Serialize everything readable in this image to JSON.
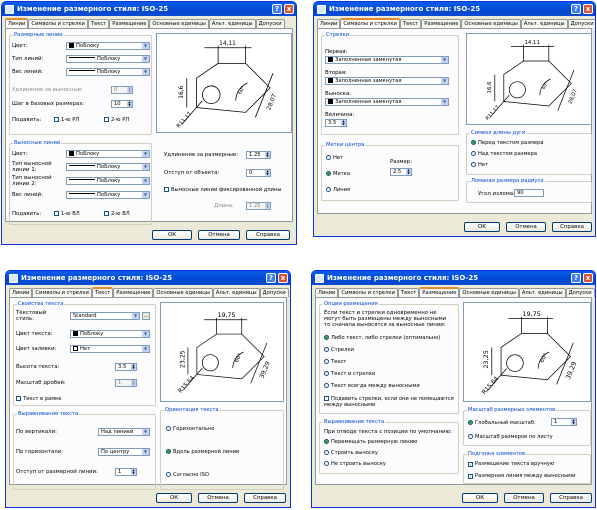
{
  "dialogs": [
    {
      "title": "Изменение размерного стиля: ISO-25",
      "tabs": [
        "Линии",
        "Символы и стрелки",
        "Текст",
        "Размещение",
        "Основные единицы",
        "Альт. единицы",
        "Допуски"
      ],
      "active": 0,
      "dims": [
        "14,11",
        "16,6",
        "28,07",
        "60°",
        "R11,17"
      ],
      "g1": "Размерные линии",
      "g2": "Выносные линии",
      "l": [
        "Цвет:",
        "Тип линий:",
        "Вес линий:",
        "Удлинение за выносные:",
        "Шаг в базовых размерах:",
        "Подавить:",
        "Цвет:",
        "Тип выносной линии 1:",
        "Тип выносной линии 2:",
        "Вес линий:",
        "Подавить:",
        "Удлинение за размерные:",
        "Отступ от объекта:",
        "Длина:"
      ],
      "v": [
        "ПоБлоку",
        "ПоБлоку",
        "ПоБлоку",
        "0",
        "10",
        "1-ю РЛ",
        "2-ю РЛ",
        "ПоБлоку",
        "ПоБлоку",
        "ПоБлоку",
        "ПоБлоку",
        "1-ю ВЛ",
        "2-ю ВЛ",
        "1.25",
        "0",
        "Выносные линии фиксированной длины",
        "1.25"
      ]
    },
    {
      "title": "Изменение размерного стиля: ISO-25",
      "tabs": [
        "Линии",
        "Символы и стрелки",
        "Текст",
        "Размещение",
        "Основные единицы",
        "Альт. единицы",
        "Допуски"
      ],
      "active": 1,
      "dims": [
        "14,11",
        "16,6",
        "28,07",
        "60°",
        "R11,17"
      ],
      "g1": "Стрелки",
      "g2": "Метки центра",
      "g3": "Символ длины дуги",
      "g4": "Ломаная размера радиуса",
      "l": [
        "Первая:",
        "Вторая:",
        "Выноска:",
        "Величина:",
        "Размер:",
        "Угол излома:"
      ],
      "v": [
        "Заполненная замкнутая",
        "Заполненная замкнутая",
        "Заполненная замкнутая",
        "3.5",
        "Нет",
        "Метка",
        "Линия",
        "2.5",
        "Перед текстом размера",
        "Над текстом размера",
        "Нет",
        "90"
      ]
    },
    {
      "title": "Изменение размерного стиля: ISO-25",
      "tabs": [
        "Линии",
        "Символы и стрелки",
        "Текст",
        "Размещение",
        "Основные единицы",
        "Альт. единицы",
        "Допуски"
      ],
      "active": 2,
      "dims": [
        "19,75",
        "23,25",
        "39,29",
        "60°",
        "R15,64"
      ],
      "g1": "Свойства текста",
      "g2": "Выравнивание текста",
      "g3": "Ориентация текста",
      "l": [
        "Текстовый стиль:",
        "Цвет текста:",
        "Цвет заливки:",
        "Высота текста:",
        "Масштаб дробей:",
        "По вертикали:",
        "По горизонтали:",
        "Отступ от размерной линии:"
      ],
      "v": [
        "Standard",
        "ПоБлоку",
        "Нет",
        "3.5",
        "1",
        "Текст в рамке",
        "Над линией",
        "По центру",
        "1",
        "Горизонтально",
        "Вдоль размерной линии",
        "Согласно ISO",
        "..."
      ]
    },
    {
      "title": "Изменение размерного стиля: ISO-25",
      "tabs": [
        "Линии",
        "Символы и стрелки",
        "Текст",
        "Размещение",
        "Основные единицы",
        "Альт. единицы",
        "Допуски"
      ],
      "active": 3,
      "dims": [
        "19,75",
        "23,25",
        "39,29",
        "60°",
        "R15,64"
      ],
      "g1": "Опции размещения",
      "g2": "Выравнивание текста",
      "g3": "Масштаб размерных элементов",
      "g4": "Подгонка элементов",
      "l": [
        "Если текст и стрелки одновременно не могут быть размещены между выносными то сначала выносятся за выносные линии:",
        "При отводе текста с позиции по умолчанию:"
      ],
      "v": [
        "Либо текст, либо стрелки (оптимально)",
        "Стрелки",
        "Текст",
        "Текст и стрелки",
        "Текст всегда между выносными",
        "Подавить стрелки, если они не помещаются между выносными",
        "Перемещать размерную линию",
        "Строить выноску",
        "Не строить выноску",
        "Глобальный масштаб:",
        "1",
        "Масштаб размеров по листу",
        "Размещение текста вручную",
        "Размерная линия между выносными"
      ]
    }
  ],
  "buttons": {
    "ok": "ОК",
    "cancel": "Отмена",
    "help": "Справка"
  },
  "titlebar": {
    "help": "?",
    "close": "x"
  }
}
